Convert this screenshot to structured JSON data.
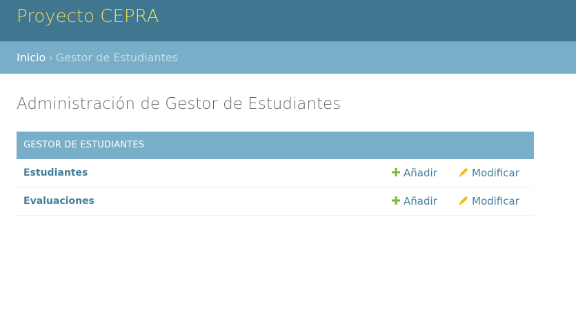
{
  "header": {
    "site_title": "Proyecto CEPRA"
  },
  "breadcrumbs": {
    "home": "Inicio",
    "separator": "›",
    "current": "Gestor de Estudiantes"
  },
  "page": {
    "title": "Administración de Gestor de Estudiantes"
  },
  "module": {
    "caption": "GESTOR DE ESTUDIANTES",
    "models": [
      {
        "name": "Estudiantes",
        "add_label": "Añadir",
        "change_label": "Modificar",
        "add_icon": "plus-icon",
        "change_icon": "pencil-icon"
      },
      {
        "name": "Evaluaciones",
        "add_label": "Añadir",
        "change_label": "Modificar",
        "add_icon": "plus-icon",
        "change_icon": "pencil-icon"
      }
    ]
  },
  "colors": {
    "header_bg": "#417690",
    "brand_text": "#f5dd5d",
    "breadcrumb_bg": "#79aec8",
    "link": "#447e9b",
    "add_icon": "#70bf2b",
    "change_icon": "#efb80b"
  }
}
